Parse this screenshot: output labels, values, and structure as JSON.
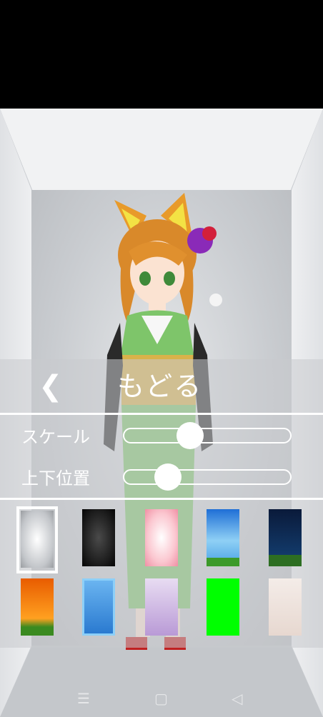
{
  "header": {
    "back_chevron": "❮",
    "back_label": "もどる"
  },
  "sliders": [
    {
      "label": "スケール",
      "value": 0.38
    },
    {
      "label": "上下位置",
      "value": 0.22
    }
  ],
  "backgrounds": [
    {
      "name": "white-room",
      "selected": true
    },
    {
      "name": "black-room",
      "selected": false
    },
    {
      "name": "pink-room",
      "selected": false
    },
    {
      "name": "blue-sky",
      "selected": false
    },
    {
      "name": "night-sky",
      "selected": false
    },
    {
      "name": "sunset",
      "selected": false
    },
    {
      "name": "blue-room",
      "selected": false
    },
    {
      "name": "purple-room",
      "selected": false
    },
    {
      "name": "green-screen",
      "selected": false
    },
    {
      "name": "character-photo",
      "selected": false
    }
  ],
  "navbar": {
    "recent_icon": "☰",
    "home_icon": "▢",
    "back_icon": "◁"
  },
  "colors": {
    "accent": "#ffffff",
    "panel": "#c8cace",
    "green_screen": "#00ff00"
  }
}
